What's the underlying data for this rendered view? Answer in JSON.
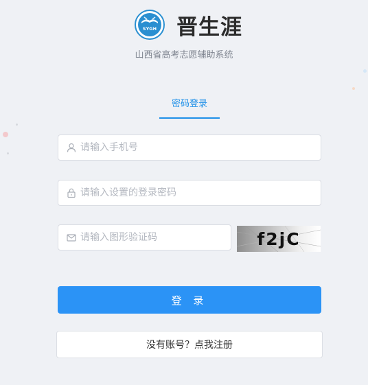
{
  "header": {
    "app_title": "晋生涯",
    "logo_text": "SYGH",
    "subtitle": "山西省高考志愿辅助系统"
  },
  "tabs": [
    {
      "label": "密码登录",
      "active": true
    }
  ],
  "form": {
    "phone": {
      "placeholder": "请输入手机号",
      "value": "",
      "icon": "user-icon"
    },
    "password": {
      "placeholder": "请输入设置的登录密码",
      "value": "",
      "icon": "lock-icon"
    },
    "captcha": {
      "placeholder": "请输入图形验证码",
      "value": "",
      "icon": "mail-icon",
      "image_text": "f2jC"
    }
  },
  "buttons": {
    "login_label": "登 录",
    "register_label": "没有账号？点我注册"
  },
  "colors": {
    "accent": "#2b93f6",
    "tab_active": "#1e90e8",
    "background": "#eff1f5"
  }
}
